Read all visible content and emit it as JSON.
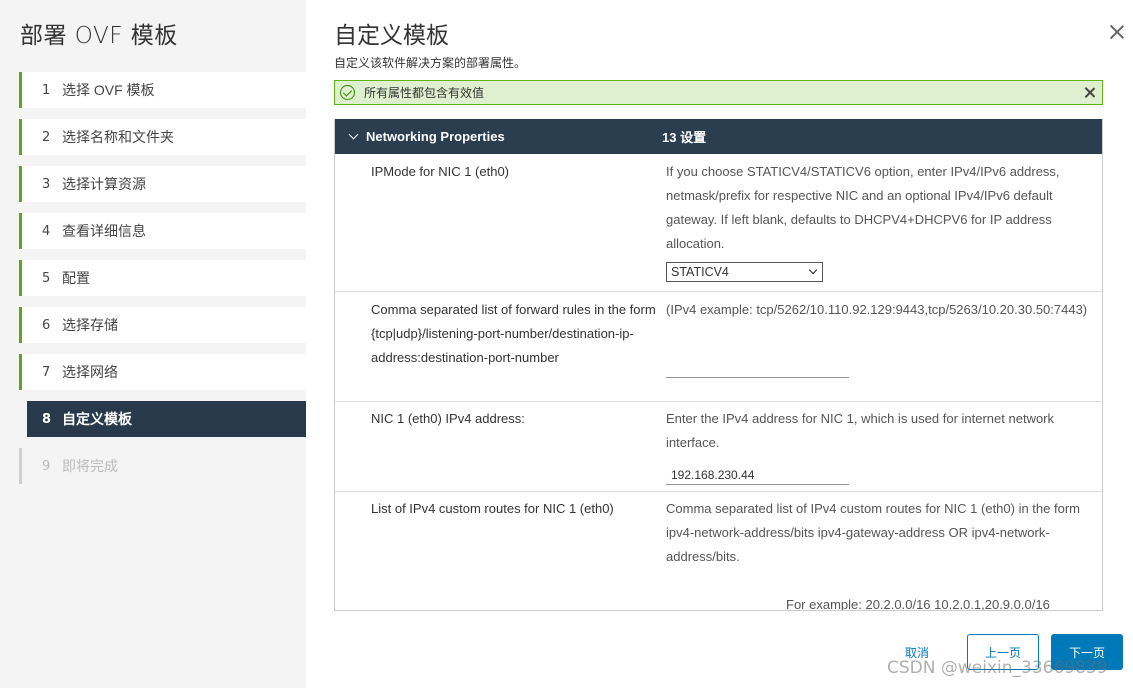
{
  "sidebar": {
    "title": "部署 OVF 模板",
    "steps": [
      {
        "num": "1",
        "label": "选择 OVF 模板"
      },
      {
        "num": "2",
        "label": "选择名称和文件夹"
      },
      {
        "num": "3",
        "label": "选择计算资源"
      },
      {
        "num": "4",
        "label": "查看详细信息"
      },
      {
        "num": "5",
        "label": "配置"
      },
      {
        "num": "6",
        "label": "选择存储"
      },
      {
        "num": "7",
        "label": "选择网络"
      },
      {
        "num": "8",
        "label": "自定义模板"
      },
      {
        "num": "9",
        "label": "即将完成"
      }
    ]
  },
  "main": {
    "title": "自定义模板",
    "subtitle": "自定义该软件解决方案的部署属性。",
    "alert": "所有属性都包含有效值",
    "grid": {
      "header_name": "Networking Properties",
      "header_count": "13 设置",
      "rows": [
        {
          "label": "IPMode for NIC 1 (eth0)",
          "desc": "If you choose STATICV4/STATICV6 option, enter IPv4/IPv6 address, netmask/prefix for respective NIC and an optional IPv4/IPv6 default gateway. If left blank, defaults to DHCPV4+DHCPV6 for IP address allocation.",
          "select_value": "STATICV4"
        },
        {
          "label": "Comma separated list of forward rules in the form {tcp|udp}/listening-port-number/destination-ip-address:destination-port-number",
          "desc": "(IPv4 example: tcp/5262/10.110.92.129:9443,tcp/5263/10.20.30.50:7443)",
          "input_value": ""
        },
        {
          "label": "NIC 1 (eth0) IPv4 address:",
          "desc": "Enter the IPv4 address for NIC 1, which is used for internet network interface.",
          "input_value": "192.168.230.44"
        },
        {
          "label": "List of IPv4 custom routes for NIC 1 (eth0)",
          "desc": "Comma separated list of IPv4 custom routes for NIC 1 (eth0) in the form ipv4-network-address/bits ipv4-gateway-address OR ipv4-network-address/bits.",
          "example": "For example: 20.2.0.0/16 10.2.0.1,20.9.0.0/16"
        }
      ]
    }
  },
  "footer": {
    "cancel": "取消",
    "back": "上一页",
    "next": "下一页"
  },
  "watermark": "CSDN @weixin_33669839"
}
